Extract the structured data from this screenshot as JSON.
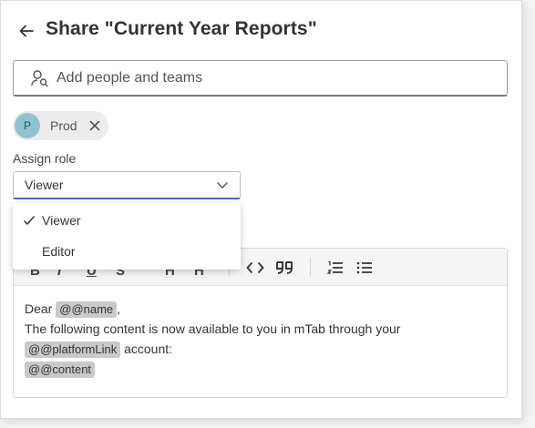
{
  "dialog": {
    "title": "Share \"Current Year Reports\"",
    "search_placeholder": "Add people and teams",
    "chip": {
      "initial": "P",
      "label": "Prod"
    },
    "assign_role_label": "Assign role",
    "role_select": {
      "value": "Viewer"
    },
    "role_options": [
      {
        "label": "Viewer",
        "selected": true
      },
      {
        "label": "Editor",
        "selected": false
      }
    ]
  },
  "editor": {
    "dear": "Dear",
    "name_tag": "@@name",
    "comma": ",",
    "line2": "The following content is now available to you in mTab through your",
    "platform_tag": "@@platformLink",
    "account_text": "account:",
    "content_tag": "@@content"
  },
  "colors": {
    "avatar_bg": "#8fc4cf",
    "select_underline": "#3d6fb0",
    "tag_bg": "#c9c9c9"
  },
  "icons": [
    "arrow-left-icon",
    "person-search-icon",
    "close-icon",
    "chevron-down-icon",
    "check-icon",
    "code-icon",
    "quote-icon",
    "numbered-list-icon",
    "bullet-list-icon"
  ]
}
